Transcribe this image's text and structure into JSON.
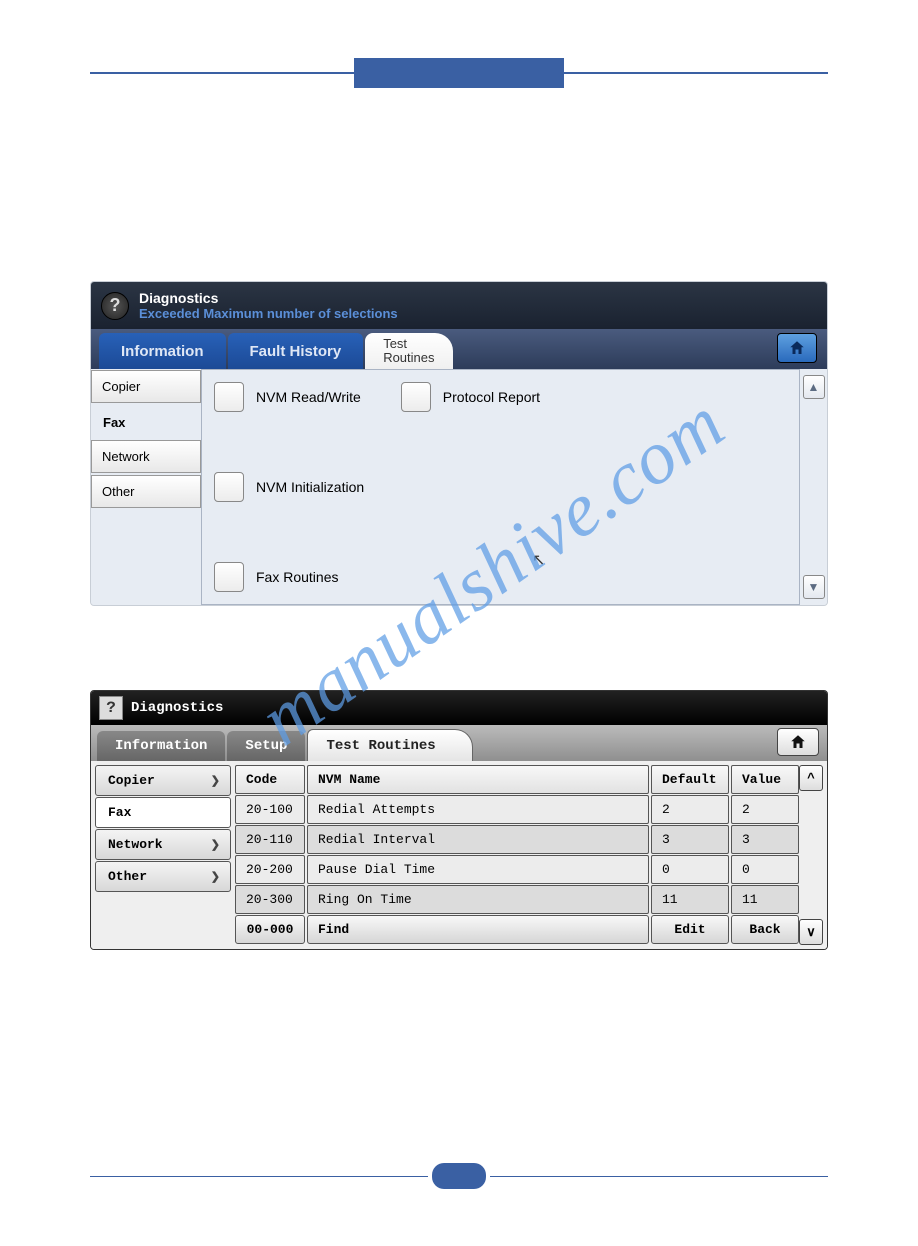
{
  "watermark": "manualshive.com",
  "shot1": {
    "title": "Diagnostics",
    "subtitle": "Exceeded Maximum number of selections",
    "tabs": {
      "information": "Information",
      "fault_history": "Fault History",
      "test_routines_l1": "Test",
      "test_routines_l2": "Routines"
    },
    "side": {
      "copier": "Copier",
      "fax": "Fax",
      "network": "Network",
      "other": "Other"
    },
    "items": {
      "nvm_rw": "NVM Read/Write",
      "protocol": "Protocol Report",
      "nvm_init": "NVM Initialization",
      "fax_routines": "Fax Routines"
    }
  },
  "shot2": {
    "title": "Diagnostics",
    "tabs": {
      "information": "Information",
      "setup": "Setup",
      "test_routines": "Test Routines"
    },
    "side": {
      "copier": "Copier",
      "fax": "Fax",
      "network": "Network",
      "other": "Other"
    },
    "headers": {
      "code": "Code",
      "name": "NVM Name",
      "default": "Default",
      "value": "Value"
    },
    "rows": [
      {
        "code": "20-100",
        "name": "Redial Attempts",
        "default": "2",
        "value": "2"
      },
      {
        "code": "20-110",
        "name": "Redial Interval",
        "default": "3",
        "value": "3"
      },
      {
        "code": "20-200",
        "name": "Pause Dial Time",
        "default": "0",
        "value": "0"
      },
      {
        "code": "20-300",
        "name": "Ring On Time",
        "default": "11",
        "value": "11"
      }
    ],
    "footer": {
      "code_input": "00-000",
      "find": "Find",
      "edit": "Edit",
      "back": "Back"
    }
  }
}
